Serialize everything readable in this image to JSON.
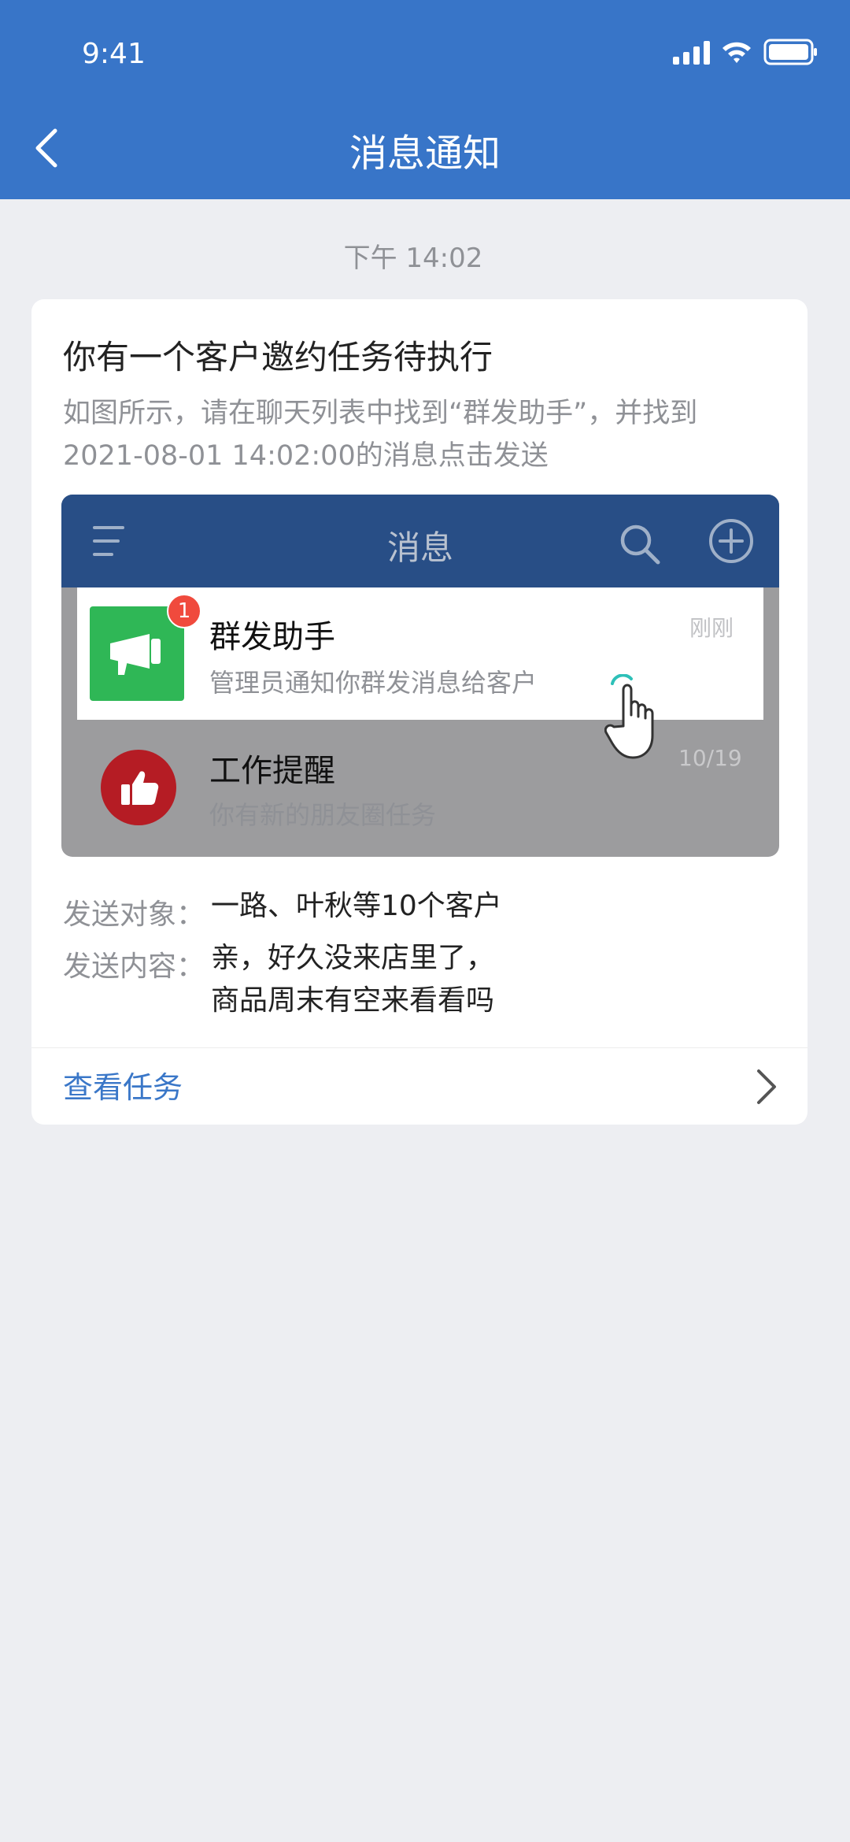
{
  "status_bar": {
    "time": "9:41"
  },
  "nav": {
    "title": "消息通知"
  },
  "timestamp": "下午 14:02",
  "card": {
    "title": "你有一个客户邀约任务待执行",
    "description_line1": "如图所示，请在聊天列表中找到“群发助手”，并找到",
    "description_line2": "2021-08-01 14:02:00的消息点击发送",
    "mockup": {
      "title": "消息",
      "rows": [
        {
          "name": "群发助手",
          "message": "管理员通知你群发消息给客户",
          "time": "刚刚",
          "badge": "1"
        },
        {
          "name": "工作提醒",
          "message": "你有新的朋友圈任务",
          "time": "10/19"
        }
      ]
    },
    "recipients_label": "发送对象：",
    "recipients_value": "一路、叶秋等10个客户",
    "content_label": "发送内容：",
    "content_line1": "亲，好久没来店里了，",
    "content_line2": "商品周末有空来看看吗",
    "view_task_label": "查看任务"
  },
  "colors": {
    "brand_blue": "#3875c8",
    "mock_header": "#284e86",
    "green_avatar": "#2fb756",
    "badge_red": "#f04a3d",
    "link_blue": "#3a77c8"
  }
}
